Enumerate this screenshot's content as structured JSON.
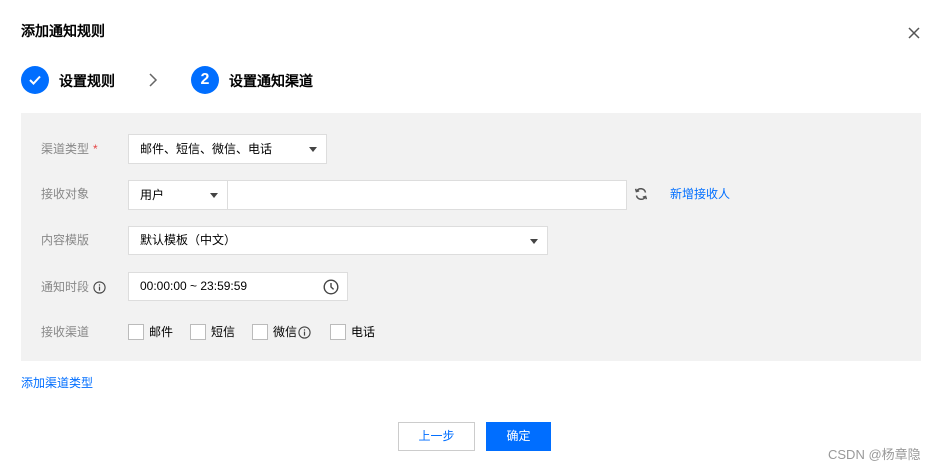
{
  "dialog": {
    "title": "添加通知规则"
  },
  "steps": [
    {
      "label": "设置规则",
      "status": "done",
      "icon": "check-icon"
    },
    {
      "number": "2",
      "label": "设置通知渠道",
      "status": "active"
    }
  ],
  "form": {
    "channel_type": {
      "label": "渠道类型",
      "required_mark": "*",
      "value": "邮件、短信、微信、电话"
    },
    "recipient": {
      "label": "接收对象",
      "type_value": "用户",
      "input_value": "",
      "add_link": "新增接收人"
    },
    "template": {
      "label": "内容模版",
      "value": "默认模板（中文）"
    },
    "time_range": {
      "label": "通知时段",
      "value": "00:00:00 ~ 23:59:59"
    },
    "channels": {
      "label": "接收渠道",
      "options": [
        {
          "label": "邮件",
          "checked": false
        },
        {
          "label": "短信",
          "checked": false
        },
        {
          "label": "微信",
          "checked": false,
          "info_icon": true
        },
        {
          "label": "电话",
          "checked": false
        }
      ]
    }
  },
  "add_channel_link": "添加渠道类型",
  "buttons": {
    "prev": "上一步",
    "confirm": "确定"
  },
  "watermark": "CSDN @杨章隐",
  "icons": {
    "close": "close-icon",
    "step_separator": "chevron-right-icon",
    "dropdown": "caret-down-icon",
    "refresh": "refresh-icon",
    "info": "info-icon",
    "time": "clock-icon"
  },
  "colors": {
    "accent": "#006eff",
    "panel_bg": "#f2f2f2",
    "required": "#e54545"
  }
}
